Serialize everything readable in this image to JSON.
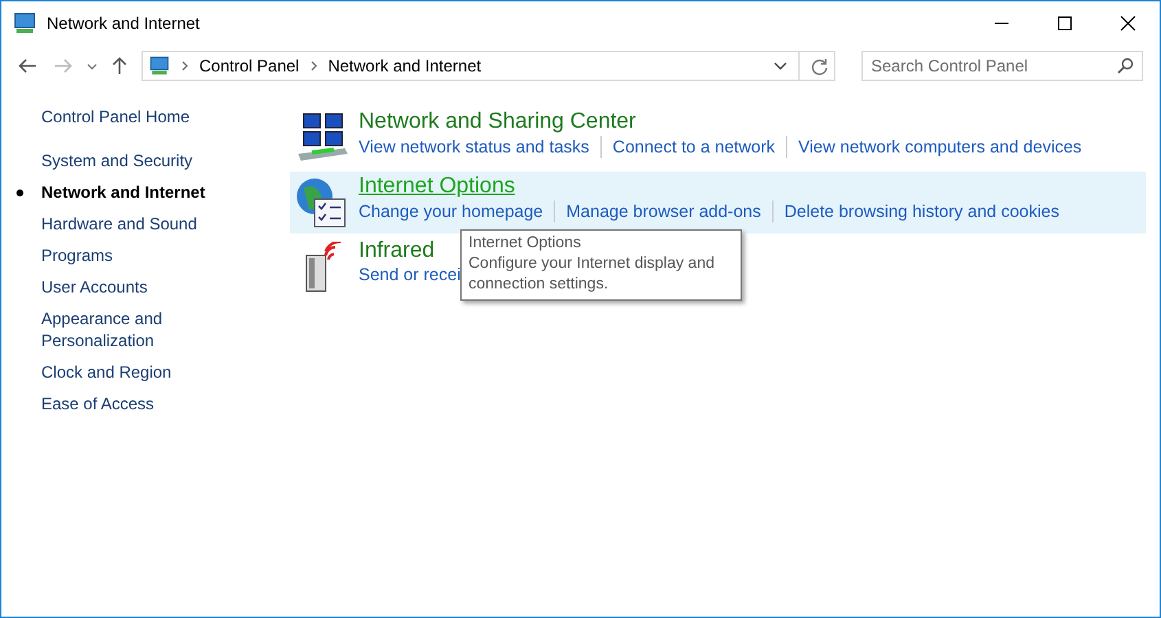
{
  "window": {
    "title": "Network and Internet"
  },
  "address_bar": {
    "breadcrumbs": [
      "Control Panel",
      "Network and Internet"
    ]
  },
  "search": {
    "placeholder": "Search Control Panel"
  },
  "sidebar": {
    "home": "Control Panel Home",
    "items": [
      {
        "label": "System and Security",
        "selected": false
      },
      {
        "label": "Network and Internet",
        "selected": true
      },
      {
        "label": "Hardware and Sound",
        "selected": false
      },
      {
        "label": "Programs",
        "selected": false
      },
      {
        "label": "User Accounts",
        "selected": false
      },
      {
        "label": "Appearance and Personalization",
        "selected": false
      },
      {
        "label": "Clock and Region",
        "selected": false
      },
      {
        "label": "Ease of Access",
        "selected": false
      }
    ]
  },
  "categories": [
    {
      "kind": "network",
      "title": "Network and Sharing Center",
      "hovered": false,
      "links": [
        "View network status and tasks",
        "Connect to a network",
        "View network computers and devices"
      ]
    },
    {
      "kind": "globe",
      "title": "Internet Options",
      "hovered": true,
      "links": [
        "Change your homepage",
        "Manage browser add-ons",
        "Delete browsing history and cookies"
      ]
    },
    {
      "kind": "infrared",
      "title": "Infrared",
      "hovered": false,
      "links": [
        "Send or recei"
      ]
    }
  ],
  "tooltip": {
    "title": "Internet Options",
    "text": "Configure your Internet display and connection settings."
  }
}
